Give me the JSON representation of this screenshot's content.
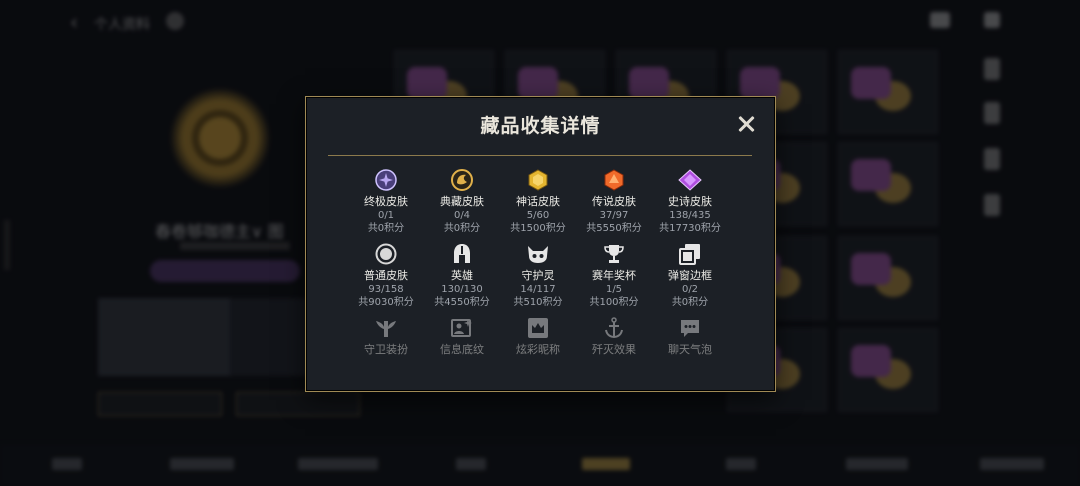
{
  "background": {
    "page_title": "个人资料",
    "player_name": "春卷够咖德主∨ 图"
  },
  "modal": {
    "title": "藏品收集详情",
    "rows": [
      [
        {
          "name": "终极皮肤",
          "count": "0/1",
          "points": "共0积分",
          "icon": "ultimate-skin-icon",
          "color": "#b9a7f0"
        },
        {
          "name": "典藏皮肤",
          "count": "0/4",
          "points": "共0积分",
          "icon": "prestige-skin-icon",
          "color": "#e0b04a"
        },
        {
          "name": "神话皮肤",
          "count": "5/60",
          "points": "共1500积分",
          "icon": "mythic-skin-icon",
          "color": "#e4b530"
        },
        {
          "name": "传说皮肤",
          "count": "37/97",
          "points": "共5550积分",
          "icon": "legendary-skin-icon",
          "color": "#f06a2a"
        },
        {
          "name": "史诗皮肤",
          "count": "138/435",
          "points": "共17730积分",
          "icon": "epic-skin-icon",
          "color": "#b04ee0"
        }
      ],
      [
        {
          "name": "普通皮肤",
          "count": "93/158",
          "points": "共9030积分",
          "icon": "common-skin-icon",
          "color": "#d8d8d8"
        },
        {
          "name": "英雄",
          "count": "130/130",
          "points": "共4550积分",
          "icon": "champion-helmet-icon",
          "color": "#e6e6e6"
        },
        {
          "name": "守护灵",
          "count": "14/117",
          "points": "共510积分",
          "icon": "guardian-spirit-icon",
          "color": "#e6e6e6"
        },
        {
          "name": "赛年奖杯",
          "count": "1/5",
          "points": "共100积分",
          "icon": "trophy-icon",
          "color": "#e6e6e6"
        },
        {
          "name": "弹窗边框",
          "count": "0/2",
          "points": "共0积分",
          "icon": "popup-frame-icon",
          "color": "#e6e6e6"
        }
      ],
      [
        {
          "name": "守卫装扮",
          "icon": "ward-skin-icon",
          "color": "#e6e6e6"
        },
        {
          "name": "信息底纹",
          "icon": "info-banner-icon",
          "color": "#e6e6e6"
        },
        {
          "name": "炫彩昵称",
          "icon": "chroma-name-icon",
          "color": "#e6e6e6"
        },
        {
          "name": "歼灭效果",
          "icon": "ace-effect-icon",
          "color": "#e6e6e6"
        },
        {
          "name": "聊天气泡",
          "icon": "chat-bubble-icon",
          "color": "#e6e6e6"
        }
      ]
    ]
  }
}
